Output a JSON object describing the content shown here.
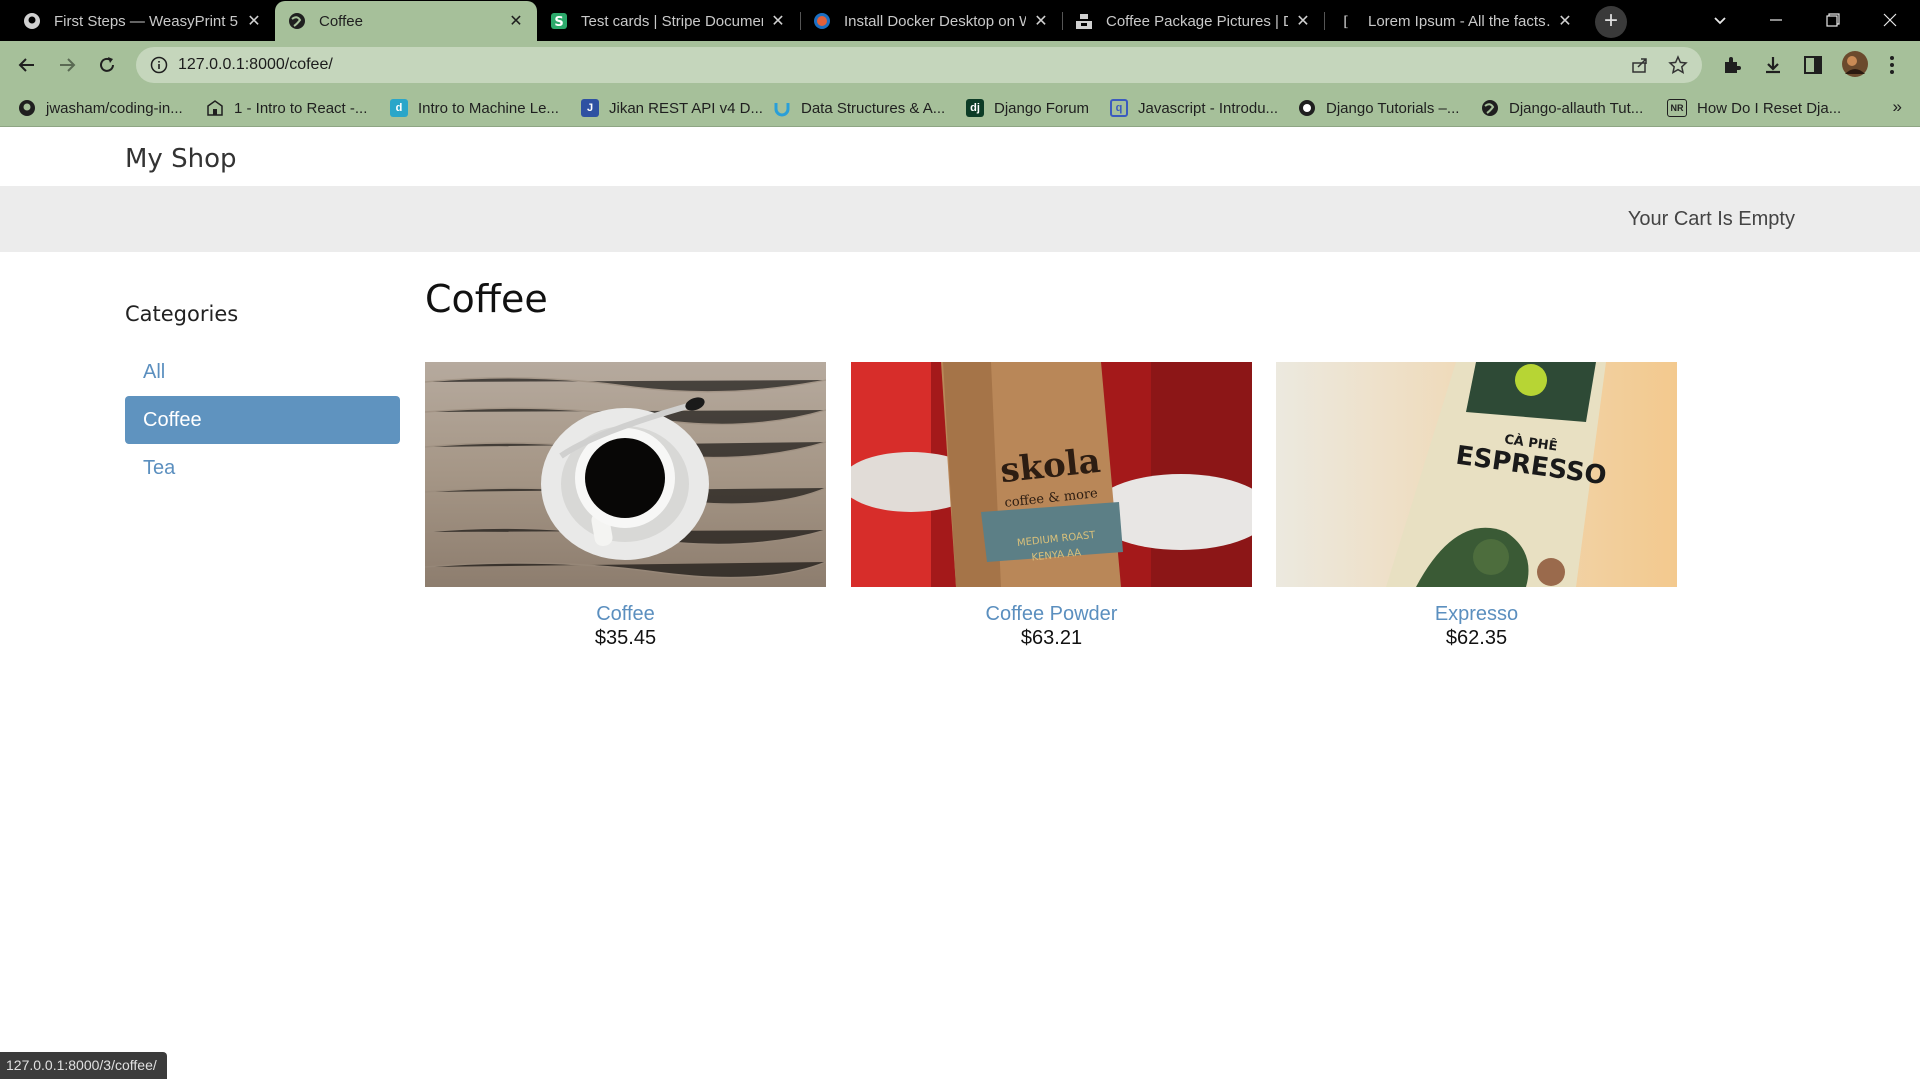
{
  "browser": {
    "tabs": [
      {
        "title": "First Steps — WeasyPrint 5…",
        "icon": "github-icon",
        "active": false
      },
      {
        "title": "Coffee",
        "icon": "globe-icon",
        "active": true
      },
      {
        "title": "Test cards | Stripe Documen…",
        "icon": "stripe-icon",
        "active": false
      },
      {
        "title": "Install Docker Desktop on W…",
        "icon": "docker-icon",
        "active": false
      },
      {
        "title": "Coffee Package Pictures | D…",
        "icon": "unsplash-icon",
        "active": false
      },
      {
        "title": "Lorem Ipsum - All the facts…",
        "icon": "lorem-icon",
        "active": false
      }
    ],
    "new_tab_label": "+",
    "url": "127.0.0.1:8000/cofee/",
    "status_url": "127.0.0.1:8000/3/coffee/",
    "accent_color": "#a6c09a"
  },
  "bookmarks": [
    {
      "label": "jwasham/coding-in...",
      "icon": "github-icon"
    },
    {
      "label": "1 - Intro to React -...",
      "icon": "school-icon"
    },
    {
      "label": "Intro to Machine Le...",
      "icon": "d-icon"
    },
    {
      "label": "Jikan REST API v4 D...",
      "icon": "j-icon"
    },
    {
      "label": "Data Structures & A...",
      "icon": "udemy-icon"
    },
    {
      "label": "Django Forum",
      "icon": "django-icon"
    },
    {
      "label": "Javascript - Introdu...",
      "icon": "q-icon"
    },
    {
      "label": "Django Tutorials –...",
      "icon": "python-icon"
    },
    {
      "label": "Django-allauth Tut...",
      "icon": "globe-icon"
    },
    {
      "label": "How Do I Reset Dja...",
      "icon": "nr-icon"
    }
  ],
  "shop": {
    "logo": "My Shop",
    "cart_status": "Your Cart Is Empty",
    "sidebar_title": "Categories",
    "categories": [
      {
        "label": "All",
        "selected": false
      },
      {
        "label": "Coffee",
        "selected": true
      },
      {
        "label": "Tea",
        "selected": false
      }
    ],
    "heading": "Coffee",
    "products": [
      {
        "name": "Coffee",
        "price": "$35.45",
        "image": "coffee-cup-photo"
      },
      {
        "name": "Coffee Powder",
        "price": "$63.21",
        "image": "coffee-bag-photo"
      },
      {
        "name": "Expresso",
        "price": "$62.35",
        "image": "espresso-pack-photo"
      }
    ],
    "link_color": "#5b8fbf",
    "selected_color": "#5f93bf"
  }
}
